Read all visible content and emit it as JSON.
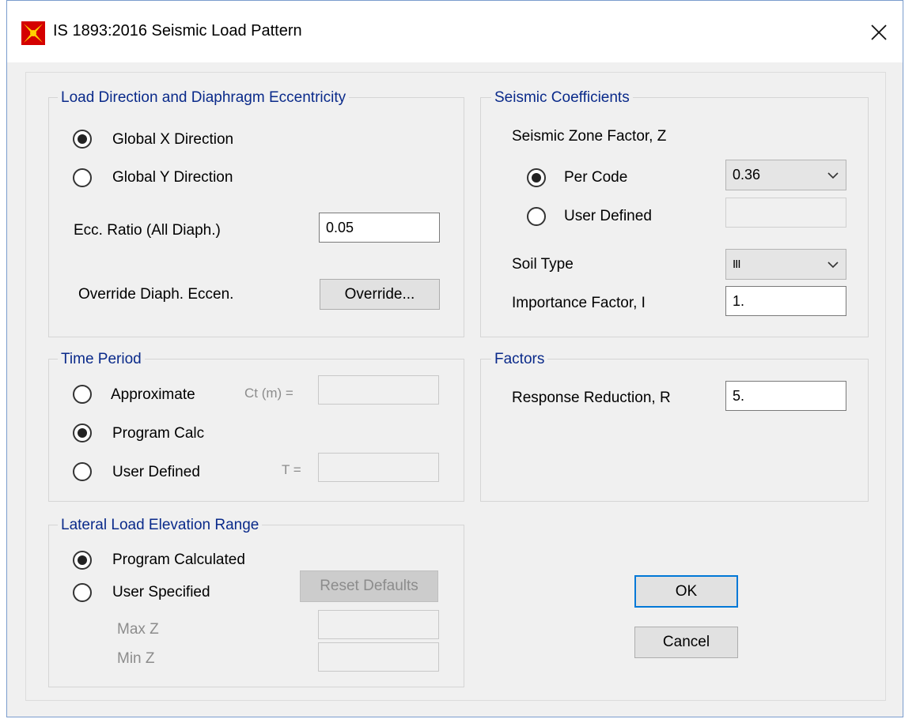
{
  "window": {
    "title": "IS 1893:2016 Seismic Load Pattern",
    "close_glyph": "✕"
  },
  "load_direction": {
    "title": "Load Direction and Diaphragm Eccentricity",
    "options": [
      {
        "label": "Global  X  Direction",
        "selected": true
      },
      {
        "label": "Global  Y  Direction",
        "selected": false
      }
    ],
    "ecc_label": "Ecc. Ratio (All Diaph.)",
    "ecc_value": "0.05",
    "override_label": "Override Diaph. Eccen.",
    "override_button": "Override..."
  },
  "seismic_coefficients": {
    "title": "Seismic Coefficients",
    "zone_label": "Seismic Zone Factor, Z",
    "per_code_label": "Per Code",
    "per_code_selected": true,
    "zone_value": "0.36",
    "user_defined_label": "User Defined",
    "user_defined_selected": false,
    "user_defined_value": "",
    "soil_type_label": "Soil Type",
    "soil_type_value": "III",
    "importance_label": "Importance Factor, I",
    "importance_value": "1."
  },
  "time_period": {
    "title": "Time Period",
    "approximate_label": "Approximate",
    "approximate_selected": false,
    "ct_label": "Ct (m) =",
    "ct_value": "",
    "program_calc_label": "Program Calc",
    "program_calc_selected": true,
    "user_defined_label": "User Defined",
    "user_defined_selected": false,
    "t_label": "T =",
    "t_value": ""
  },
  "factors": {
    "title": "Factors",
    "response_label": "Response Reduction, R",
    "response_value": "5."
  },
  "lateral_load": {
    "title": "Lateral Load Elevation Range",
    "program_calculated_label": "Program Calculated",
    "program_calculated_selected": true,
    "user_specified_label": "User Specified",
    "user_specified_selected": false,
    "reset_button": "Reset Defaults",
    "max_z_label": "Max Z",
    "max_z_value": "",
    "min_z_label": "Min Z",
    "min_z_value": ""
  },
  "buttons": {
    "ok": "OK",
    "cancel": "Cancel"
  },
  "icons": {
    "app": "etabs-app-icon",
    "close": "close-icon",
    "dropdown": "chevron-down-icon"
  },
  "colors": {
    "group_title": "#0a2a8a",
    "dialog_bg": "#f0f0f0",
    "default_button_border": "#0078d7"
  }
}
